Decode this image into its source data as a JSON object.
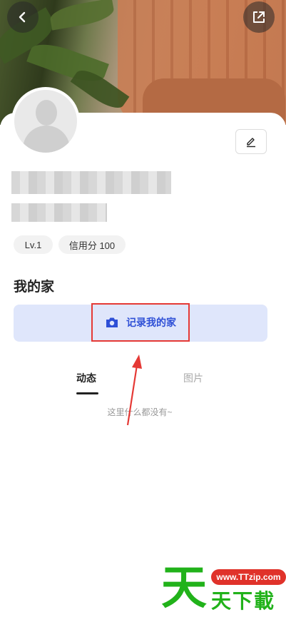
{
  "header": {
    "back_icon": "chevron-left-icon",
    "share_icon": "share-external-icon"
  },
  "profile": {
    "avatar": "default-avatar",
    "edit_icon": "pencil-icon",
    "level_label": "Lv.1",
    "credit_label": "信用分 100"
  },
  "home": {
    "section_title": "我的家",
    "record_label": "记录我的家",
    "record_icon": "camera-icon"
  },
  "tabs": [
    {
      "label": "动态",
      "active": true
    },
    {
      "label": "图片",
      "active": false
    }
  ],
  "empty_text": "这里什么都没有~",
  "watermark": {
    "badge": "www.TTzip.com",
    "big_char": "天",
    "small_text": "天下載"
  },
  "colors": {
    "accent_blue": "#2e4fd6",
    "banner_bg": "#dfe6fb",
    "highlight_red": "#e53935",
    "watermark_green": "#21b21a"
  }
}
